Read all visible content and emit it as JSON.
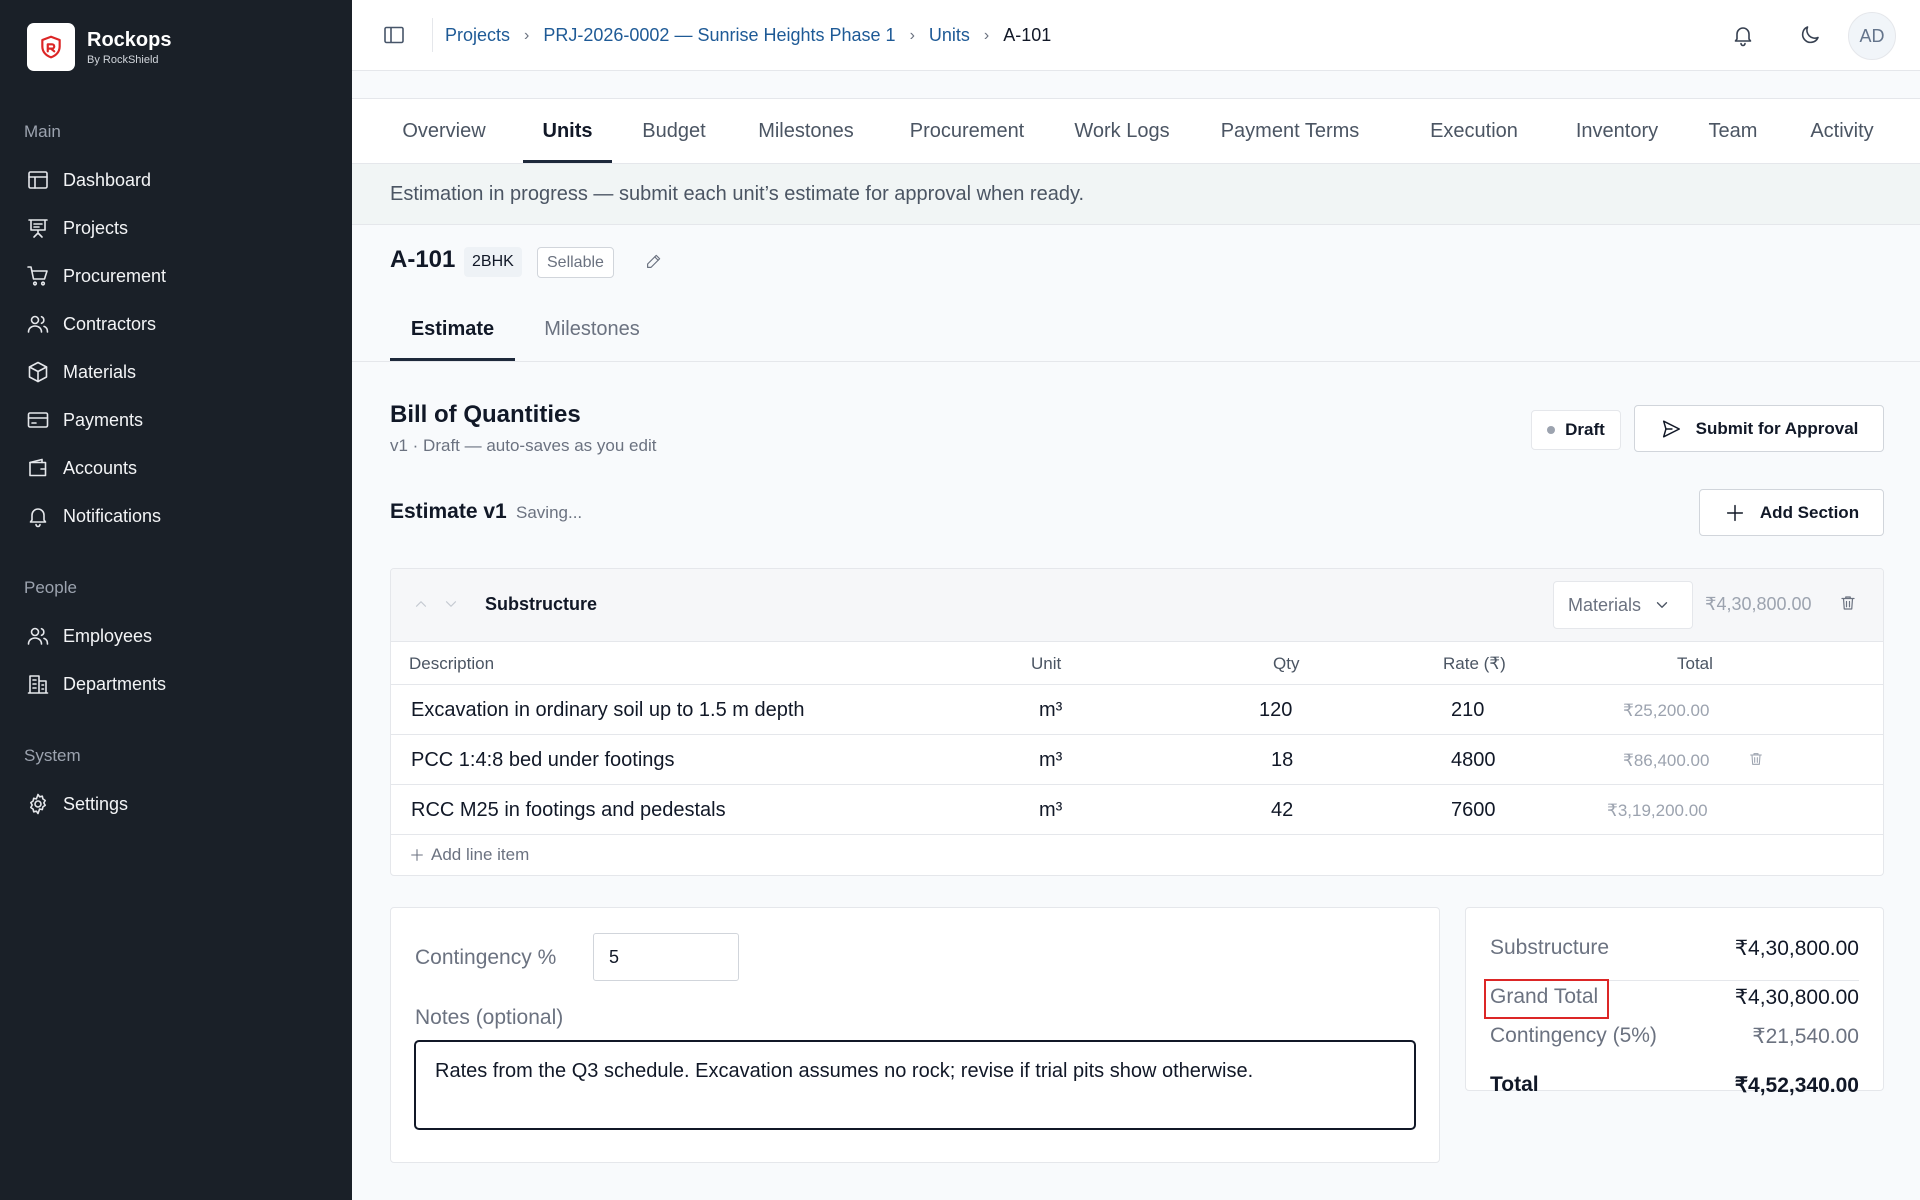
{
  "brand": {
    "name": "Rockops",
    "subtitle": "By RockShield"
  },
  "sidebar": {
    "sections": [
      {
        "heading": "Main",
        "items": [
          {
            "label": "Dashboard",
            "icon": "dashboard-icon"
          },
          {
            "label": "Projects",
            "icon": "projects-icon"
          },
          {
            "label": "Procurement",
            "icon": "cart-icon"
          },
          {
            "label": "Contractors",
            "icon": "users-icon"
          },
          {
            "label": "Materials",
            "icon": "box-icon"
          },
          {
            "label": "Payments",
            "icon": "card-icon"
          },
          {
            "label": "Accounts",
            "icon": "wallet-icon"
          },
          {
            "label": "Notifications",
            "icon": "bell-icon"
          }
        ]
      },
      {
        "heading": "People",
        "items": [
          {
            "label": "Employees",
            "icon": "users-icon"
          },
          {
            "label": "Departments",
            "icon": "building-icon"
          }
        ]
      },
      {
        "heading": "System",
        "items": [
          {
            "label": "Settings",
            "icon": "gear-icon"
          }
        ]
      }
    ]
  },
  "breadcrumb": {
    "items": [
      "Projects",
      "PRJ-2026-0002 — Sunrise Heights Phase 1",
      "Units"
    ],
    "current": "A-101"
  },
  "header": {
    "avatar_initials": "AD"
  },
  "main_tabs": [
    "Overview",
    "Units",
    "Budget",
    "Milestones",
    "Procurement",
    "Work Logs",
    "Payment Terms",
    "Execution",
    "Inventory",
    "Team",
    "Activity"
  ],
  "main_tab_active": "Units",
  "banner": "Estimation in progress — submit each unit’s estimate for approval when ready.",
  "unit": {
    "code": "A-101",
    "type": "2BHK",
    "status": "Sellable"
  },
  "sub_tabs": [
    "Estimate",
    "Milestones"
  ],
  "sub_tab_active": "Estimate",
  "boq": {
    "title": "Bill of Quantities",
    "subtitle": "v1 · Draft — auto-saves as you edit",
    "status": "Draft",
    "submit_label": "Submit for Approval",
    "estimate_title": "Estimate v1",
    "saving_text": "Saving...",
    "add_section_label": "Add Section"
  },
  "section": {
    "name": "Substructure",
    "category": "Materials",
    "total": "₹4,30,800.00",
    "columns": [
      "Description",
      "Unit",
      "Qty",
      "Rate (₹)",
      "Total"
    ],
    "rows": [
      {
        "description": "Excavation in ordinary soil up to 1.5 m depth",
        "unit": "m³",
        "qty": "120",
        "rate": "210",
        "total": "₹25,200.00"
      },
      {
        "description": "PCC 1:4:8 bed under footings",
        "unit": "m³",
        "qty": "18",
        "rate": "4800",
        "total": "₹86,400.00"
      },
      {
        "description": "RCC M25 in footings and pedestals",
        "unit": "m³",
        "qty": "42",
        "rate": "7600",
        "total": "₹3,19,200.00"
      }
    ],
    "add_line_label": "Add line item"
  },
  "contingency": {
    "label": "Contingency %",
    "value": "5"
  },
  "notes": {
    "label": "Notes (optional)",
    "value": "Rates from the Q3 schedule. Excavation assumes no rock; revise if trial pits show otherwise."
  },
  "summary": {
    "substructure_label": "Substructure",
    "substructure_value": "₹4,30,800.00",
    "grand_total_label": "Grand Total",
    "grand_total_value": "₹4,30,800.00",
    "contingency_label": "Contingency (5%)",
    "contingency_value": "₹21,540.00",
    "total_label": "Total",
    "total_value": "₹4,52,340.00"
  },
  "colors": {
    "sidebar_bg": "#1a2028",
    "link": "#1e5a96",
    "highlight_box": "#dc2626"
  }
}
